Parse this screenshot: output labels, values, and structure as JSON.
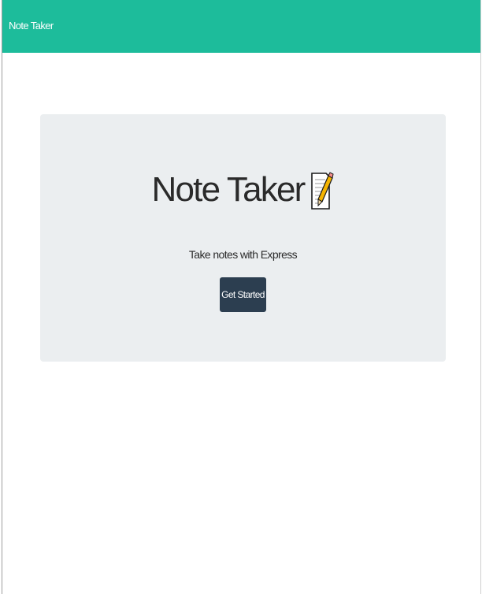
{
  "navbar": {
    "brand_label": "Note Taker",
    "background_color": "#1dbc9b"
  },
  "hero": {
    "title": "Note Taker",
    "title_icon": "memo-icon",
    "subtitle": "Take notes with Express",
    "cta_label": "Get Started",
    "background_color": "#ebeef0",
    "cta_color": "#2c3e50"
  }
}
